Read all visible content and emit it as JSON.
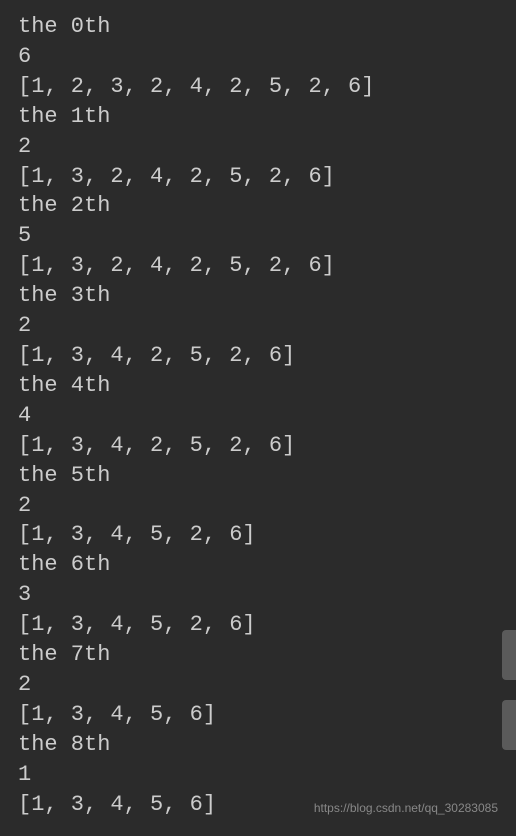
{
  "console_output": {
    "iterations": [
      {
        "header": "the 0th",
        "value": "6",
        "array": "[1, 2, 3, 2, 4, 2, 5, 2, 6]"
      },
      {
        "header": "the 1th",
        "value": "2",
        "array": "[1, 3, 2, 4, 2, 5, 2, 6]"
      },
      {
        "header": "the 2th",
        "value": "5",
        "array": "[1, 3, 2, 4, 2, 5, 2, 6]"
      },
      {
        "header": "the 3th",
        "value": "2",
        "array": "[1, 3, 4, 2, 5, 2, 6]"
      },
      {
        "header": "the 4th",
        "value": "4",
        "array": "[1, 3, 4, 2, 5, 2, 6]"
      },
      {
        "header": "the 5th",
        "value": "2",
        "array": "[1, 3, 4, 5, 2, 6]"
      },
      {
        "header": "the 6th",
        "value": "3",
        "array": "[1, 3, 4, 5, 2, 6]"
      },
      {
        "header": "the 7th",
        "value": "2",
        "array": "[1, 3, 4, 5, 6]"
      },
      {
        "header": "the 8th",
        "value": "1",
        "array": "[1, 3, 4, 5, 6]"
      }
    ]
  },
  "watermark": "https://blog.csdn.net/qq_30283085"
}
